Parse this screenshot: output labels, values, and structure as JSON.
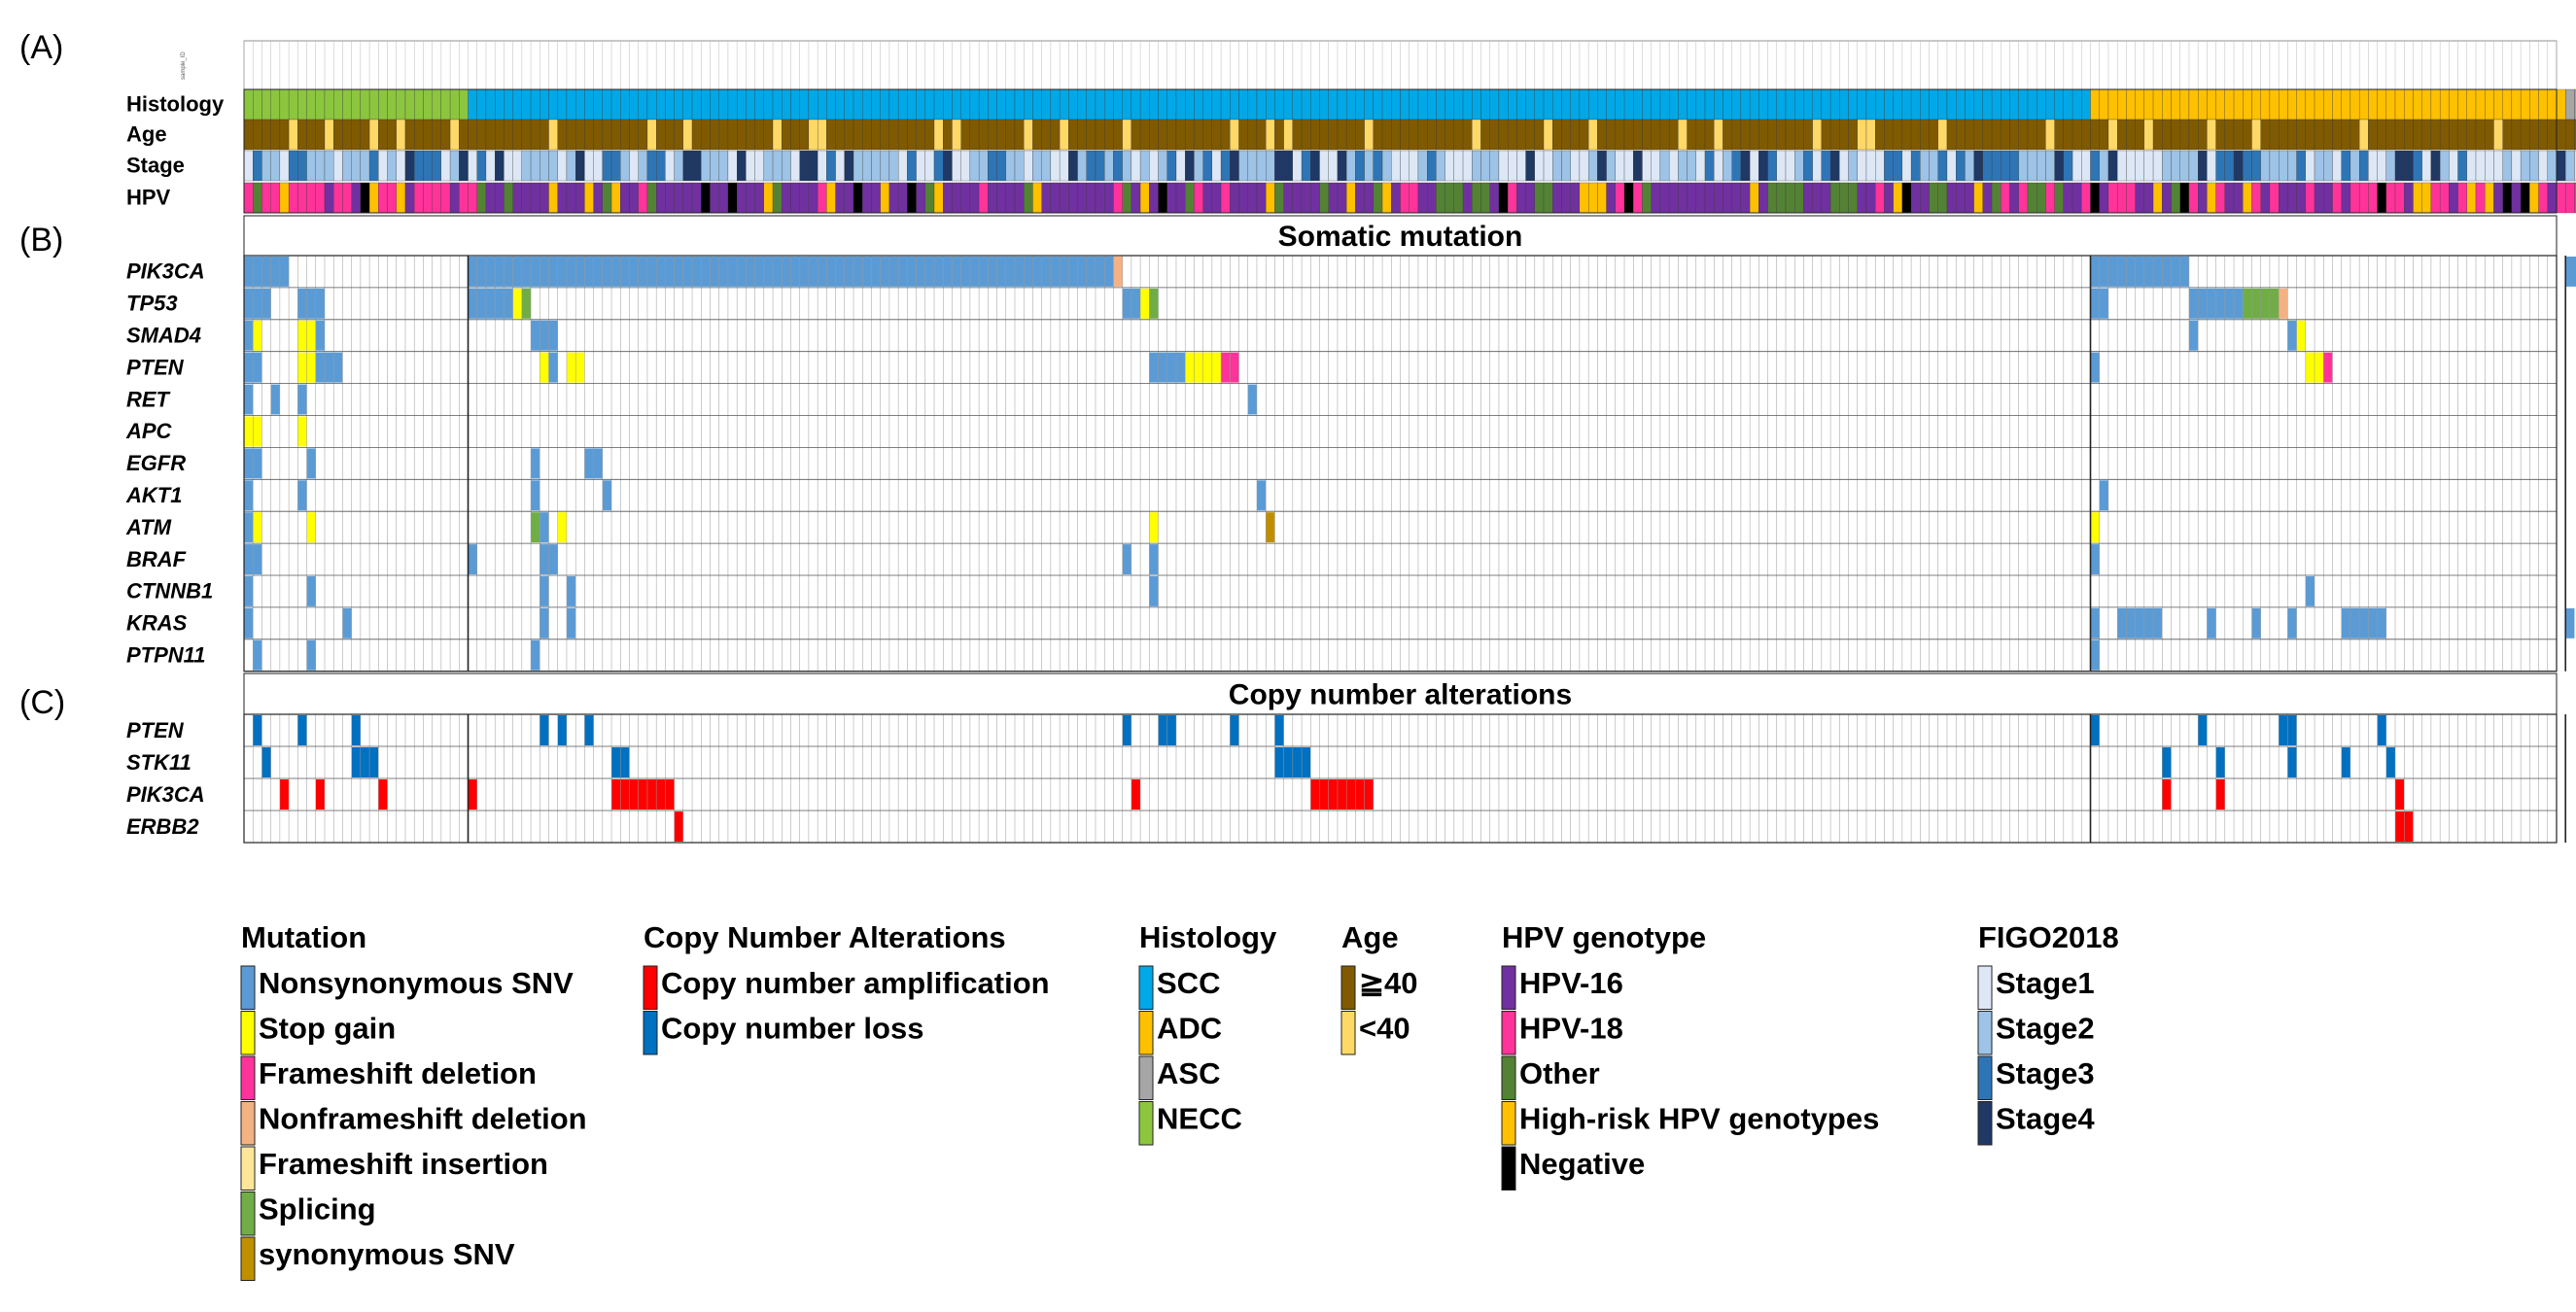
{
  "panel_labels": [
    "(A)",
    "(B)",
    "(C)"
  ],
  "sample_id_label": "sample_ID",
  "colors": {
    "histology": {
      "SCC": "#00a8e8",
      "ADC": "#ffc000",
      "ASC": "#a6a6a6",
      "NECC": "#8cc63f"
    },
    "age": {
      "ge40": "#7f5a00",
      "lt40": "#ffd966"
    },
    "stage": {
      "Stage1": "#dde7f5",
      "Stage2": "#9dc3e6",
      "Stage3": "#2e75b6",
      "Stage4": "#1f3864"
    },
    "hpv": {
      "HPV-16": "#7030a0",
      "HPV-18": "#ff3399",
      "Other": "#548235",
      "High-risk HPV genotypes": "#ffc000",
      "Negative": "#000000"
    },
    "mutation": {
      "Nonsynonymous SNV": "#5b9bd5",
      "Stop gain": "#ffff00",
      "Frameshift deletion": "#ff3399",
      "Nonframeshift deletion": "#f4b183",
      "Frameshift insertion": "#ffe699",
      "Splicing": "#70ad47",
      "synonymous SNV": "#bf8f00"
    },
    "cna": {
      "Copy number amplification": "#ff0000",
      "Copy number loss": "#0070c0"
    }
  },
  "chart_data": {
    "type": "heatmap",
    "samples": {
      "total": 258,
      "group_order": [
        "NECC",
        "SCC",
        "ADC",
        "ASC"
      ],
      "group_counts": [
        25,
        181,
        53,
        14
      ]
    },
    "annotation_tracks": {
      "labels": [
        "Histology",
        "Age",
        "Stage",
        "HPV"
      ],
      "age_lt40_samples": [
        5,
        9,
        14,
        17,
        23,
        34,
        45,
        49,
        59,
        63,
        64,
        77,
        79,
        87,
        91,
        98,
        110,
        114,
        116,
        125,
        137,
        137,
        145,
        150,
        160,
        164,
        175,
        180,
        181,
        189,
        201,
        208,
        212,
        219,
        224,
        236,
        251,
        262,
        265
      ],
      "hpv_pattern": "mixed: HPV-16 dominant in SCC, HPV-18 dominant in NECC/ADC"
    },
    "sections": [
      {
        "title": "Somatic mutation",
        "genes": [
          "PIK3CA",
          "TP53",
          "SMAD4",
          "PTEN",
          "RET",
          "APC",
          "EGFR",
          "AKT1",
          "ATM",
          "BRAF",
          "CTNNB1",
          "KRAS",
          "PTPN11"
        ],
        "cells": [
          {
            "gene": "PIK3CA",
            "samples": [
              [
                0,
                5,
                "Nonsynonymous SNV"
              ],
              [
                25,
                97,
                "Nonsynonymous SNV"
              ],
              [
                97,
                98,
                "Nonframeshift deletion"
              ],
              [
                206,
                217,
                "Nonsynonymous SNV"
              ],
              [
                259,
                261,
                "Nonsynonymous SNV"
              ]
            ]
          },
          {
            "gene": "TP53",
            "samples": [
              [
                0,
                3,
                "Nonsynonymous SNV"
              ],
              [
                6,
                9,
                "Nonsynonymous SNV"
              ],
              [
                25,
                30,
                "Nonsynonymous SNV"
              ],
              [
                30,
                31,
                "Stop gain"
              ],
              [
                31,
                32,
                "Splicing"
              ],
              [
                98,
                100,
                "Nonsynonymous SNV"
              ],
              [
                100,
                101,
                "Stop gain"
              ],
              [
                101,
                102,
                "Splicing"
              ],
              [
                206,
                208,
                "Nonsynonymous SNV"
              ],
              [
                217,
                223,
                "Nonsynonymous SNV"
              ],
              [
                223,
                227,
                "Splicing"
              ],
              [
                227,
                228,
                "Nonframeshift deletion"
              ],
              [
                261,
                262,
                "Nonsynonymous SNV"
              ]
            ]
          },
          {
            "gene": "SMAD4",
            "samples": [
              [
                0,
                1,
                "Nonsynonymous SNV"
              ],
              [
                1,
                2,
                "Stop gain"
              ],
              [
                6,
                8,
                "Stop gain"
              ],
              [
                8,
                9,
                "Nonsynonymous SNV"
              ],
              [
                32,
                35,
                "Nonsynonymous SNV"
              ],
              [
                217,
                218,
                "Nonsynonymous SNV"
              ],
              [
                228,
                229,
                "Nonsynonymous SNV"
              ],
              [
                229,
                230,
                "Stop gain"
              ]
            ]
          },
          {
            "gene": "PTEN",
            "samples": [
              [
                0,
                2,
                "Nonsynonymous SNV"
              ],
              [
                6,
                8,
                "Stop gain"
              ],
              [
                8,
                10,
                "Nonsynonymous SNV"
              ],
              [
                10,
                11,
                "Nonsynonymous SNV"
              ],
              [
                33,
                34,
                "Stop gain"
              ],
              [
                34,
                35,
                "Nonsynonymous SNV"
              ],
              [
                36,
                38,
                "Stop gain"
              ],
              [
                101,
                105,
                "Nonsynonymous SNV"
              ],
              [
                105,
                109,
                "Stop gain"
              ],
              [
                109,
                111,
                "Frameshift deletion"
              ],
              [
                206,
                207,
                "Nonsynonymous SNV"
              ],
              [
                230,
                232,
                "Stop gain"
              ],
              [
                232,
                233,
                "Frameshift deletion"
              ]
            ]
          },
          {
            "gene": "RET",
            "samples": [
              [
                0,
                1,
                "Nonsynonymous SNV"
              ],
              [
                3,
                4,
                "Nonsynonymous SNV"
              ],
              [
                6,
                7,
                "Nonsynonymous SNV"
              ],
              [
                112,
                113,
                "Nonsynonymous SNV"
              ]
            ]
          },
          {
            "gene": "APC",
            "samples": [
              [
                0,
                2,
                "Stop gain"
              ],
              [
                6,
                7,
                "Stop gain"
              ]
            ]
          },
          {
            "gene": "EGFR",
            "samples": [
              [
                0,
                2,
                "Nonsynonymous SNV"
              ],
              [
                7,
                8,
                "Nonsynonymous SNV"
              ],
              [
                32,
                33,
                "Nonsynonymous SNV"
              ],
              [
                38,
                40,
                "Nonsynonymous SNV"
              ]
            ]
          },
          {
            "gene": "AKT1",
            "samples": [
              [
                0,
                1,
                "Nonsynonymous SNV"
              ],
              [
                6,
                7,
                "Nonsynonymous SNV"
              ],
              [
                32,
                33,
                "Nonsynonymous SNV"
              ],
              [
                40,
                41,
                "Nonsynonymous SNV"
              ],
              [
                113,
                114,
                "Nonsynonymous SNV"
              ],
              [
                207,
                208,
                "Nonsynonymous SNV"
              ]
            ]
          },
          {
            "gene": "ATM",
            "samples": [
              [
                0,
                1,
                "Nonsynonymous SNV"
              ],
              [
                1,
                2,
                "Stop gain"
              ],
              [
                7,
                8,
                "Stop gain"
              ],
              [
                32,
                33,
                "Splicing"
              ],
              [
                33,
                34,
                "Nonsynonymous SNV"
              ],
              [
                35,
                36,
                "Stop gain"
              ],
              [
                101,
                102,
                "Stop gain"
              ],
              [
                114,
                115,
                "synonymous SNV"
              ],
              [
                206,
                207,
                "Stop gain"
              ]
            ]
          },
          {
            "gene": "BRAF",
            "samples": [
              [
                0,
                2,
                "Nonsynonymous SNV"
              ],
              [
                25,
                26,
                "Nonsynonymous SNV"
              ],
              [
                33,
                35,
                "Nonsynonymous SNV"
              ],
              [
                98,
                99,
                "Nonsynonymous SNV"
              ],
              [
                101,
                102,
                "Nonsynonymous SNV"
              ],
              [
                206,
                207,
                "Nonsynonymous SNV"
              ]
            ]
          },
          {
            "gene": "CTNNB1",
            "samples": [
              [
                0,
                1,
                "Nonsynonymous SNV"
              ],
              [
                7,
                8,
                "Nonsynonymous SNV"
              ],
              [
                33,
                34,
                "Nonsynonymous SNV"
              ],
              [
                36,
                37,
                "Nonsynonymous SNV"
              ],
              [
                101,
                102,
                "Nonsynonymous SNV"
              ],
              [
                230,
                231,
                "Nonsynonymous SNV"
              ]
            ]
          },
          {
            "gene": "KRAS",
            "samples": [
              [
                0,
                1,
                "Nonsynonymous SNV"
              ],
              [
                11,
                12,
                "Nonsynonymous SNV"
              ],
              [
                33,
                34,
                "Nonsynonymous SNV"
              ],
              [
                36,
                37,
                "Nonsynonymous SNV"
              ],
              [
                206,
                207,
                "Nonsynonymous SNV"
              ],
              [
                209,
                214,
                "Nonsynonymous SNV"
              ],
              [
                219,
                220,
                "Nonsynonymous SNV"
              ],
              [
                224,
                225,
                "Nonsynonymous SNV"
              ],
              [
                228,
                229,
                "Nonsynonymous SNV"
              ],
              [
                234,
                239,
                "Nonsynonymous SNV"
              ],
              [
                259,
                260,
                "Nonsynonymous SNV"
              ]
            ]
          },
          {
            "gene": "PTPN11",
            "samples": [
              [
                1,
                2,
                "Nonsynonymous SNV"
              ],
              [
                7,
                8,
                "Nonsynonymous SNV"
              ],
              [
                32,
                33,
                "Nonsynonymous SNV"
              ],
              [
                206,
                207,
                "Nonsynonymous SNV"
              ]
            ]
          }
        ]
      },
      {
        "title": "Copy number alterations",
        "genes": [
          "PTEN",
          "STK11",
          "PIK3CA",
          "ERBB2"
        ],
        "cells": [
          {
            "gene": "PTEN",
            "samples": [
              [
                1,
                2,
                "Copy number loss"
              ],
              [
                6,
                7,
                "Copy number loss"
              ],
              [
                12,
                13,
                "Copy number loss"
              ],
              [
                33,
                34,
                "Copy number loss"
              ],
              [
                35,
                36,
                "Copy number loss"
              ],
              [
                38,
                39,
                "Copy number loss"
              ],
              [
                98,
                99,
                "Copy number loss"
              ],
              [
                102,
                104,
                "Copy number loss"
              ],
              [
                110,
                111,
                "Copy number loss"
              ],
              [
                115,
                116,
                "Copy number loss"
              ],
              [
                206,
                207,
                "Copy number loss"
              ],
              [
                218,
                219,
                "Copy number loss"
              ],
              [
                227,
                229,
                "Copy number loss"
              ],
              [
                238,
                239,
                "Copy number loss"
              ],
              [
                262,
                263,
                "Copy number loss"
              ]
            ]
          },
          {
            "gene": "STK11",
            "samples": [
              [
                2,
                3,
                "Copy number loss"
              ],
              [
                12,
                15,
                "Copy number loss"
              ],
              [
                41,
                43,
                "Copy number loss"
              ],
              [
                115,
                119,
                "Copy number loss"
              ],
              [
                214,
                215,
                "Copy number loss"
              ],
              [
                220,
                221,
                "Copy number loss"
              ],
              [
                228,
                229,
                "Copy number loss"
              ],
              [
                234,
                235,
                "Copy number loss"
              ],
              [
                239,
                240,
                "Copy number loss"
              ]
            ]
          },
          {
            "gene": "PIK3CA",
            "samples": [
              [
                4,
                5,
                "Copy number amplification"
              ],
              [
                8,
                9,
                "Copy number amplification"
              ],
              [
                15,
                16,
                "Copy number amplification"
              ],
              [
                25,
                26,
                "Copy number amplification"
              ],
              [
                41,
                48,
                "Copy number amplification"
              ],
              [
                99,
                100,
                "Copy number amplification"
              ],
              [
                119,
                126,
                "Copy number amplification"
              ],
              [
                214,
                215,
                "Copy number amplification"
              ],
              [
                220,
                221,
                "Copy number amplification"
              ],
              [
                240,
                241,
                "Copy number amplification"
              ]
            ]
          },
          {
            "gene": "ERBB2",
            "samples": [
              [
                48,
                49,
                "Copy number amplification"
              ],
              [
                240,
                242,
                "Copy number amplification"
              ],
              [
                261,
                262,
                "Copy number amplification"
              ]
            ]
          }
        ]
      }
    ],
    "legends": [
      {
        "title": "Mutation",
        "items": [
          "Nonsynonymous SNV",
          "Stop gain",
          "Frameshift deletion",
          "Nonframeshift deletion",
          "Frameshift insertion",
          "Splicing",
          "synonymous SNV"
        ]
      },
      {
        "title": "Copy Number Alterations",
        "items": [
          "Copy number amplification",
          "Copy number loss"
        ]
      },
      {
        "title": "Histology",
        "items": [
          "SCC",
          "ADC",
          "ASC",
          "NECC"
        ]
      },
      {
        "title": "Age",
        "items": [
          "≧40",
          "<40"
        ]
      },
      {
        "title": "HPV genotype",
        "items": [
          "HPV-16",
          "HPV-18",
          "Other",
          "High-risk HPV genotypes",
          "Negative"
        ]
      },
      {
        "title": "FIGO2018",
        "items": [
          "Stage1",
          "Stage2",
          "Stage3",
          "Stage4"
        ]
      }
    ]
  }
}
